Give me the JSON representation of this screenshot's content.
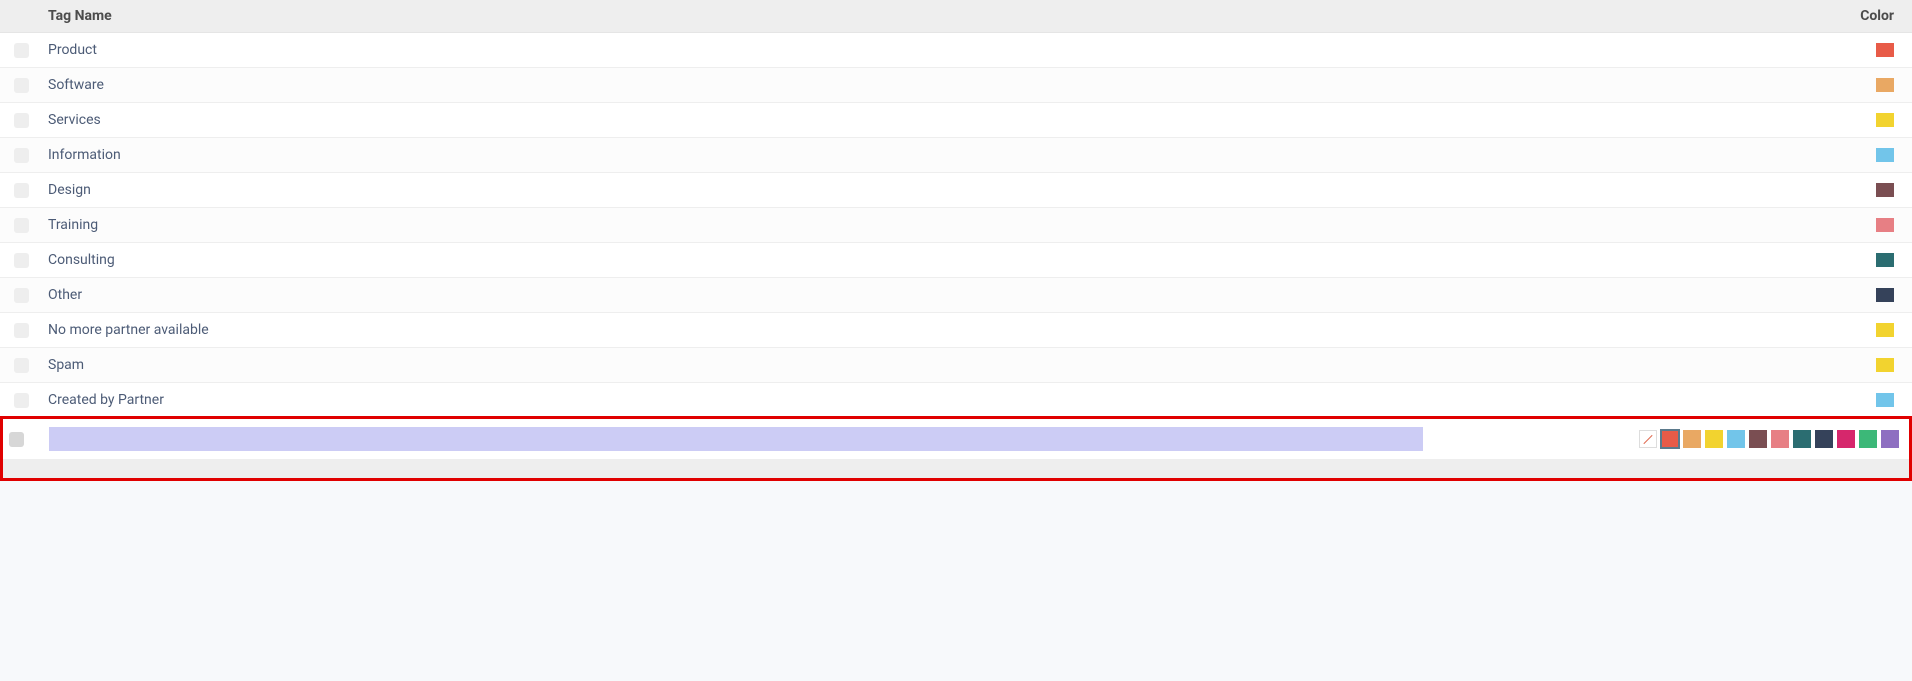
{
  "header": {
    "tag_name": "Tag Name",
    "color": "Color"
  },
  "rows": [
    {
      "name": "Product",
      "color": "#e85b48"
    },
    {
      "name": "Software",
      "color": "#e9a863"
    },
    {
      "name": "Services",
      "color": "#f2d32f"
    },
    {
      "name": "Information",
      "color": "#72c5ea"
    },
    {
      "name": "Design",
      "color": "#7a4e52"
    },
    {
      "name": "Training",
      "color": "#e77f84"
    },
    {
      "name": "Consulting",
      "color": "#2b6d71"
    },
    {
      "name": "Other",
      "color": "#35425a"
    },
    {
      "name": "No more partner available",
      "color": "#f2d32f"
    },
    {
      "name": "Spam",
      "color": "#f2d32f"
    },
    {
      "name": "Created by Partner",
      "color": "#72c5ea"
    }
  ],
  "new_row": {
    "value": "",
    "palette": [
      {
        "color": null,
        "selected": false
      },
      {
        "color": "#e85b48",
        "selected": true
      },
      {
        "color": "#e9a863",
        "selected": false
      },
      {
        "color": "#f2d32f",
        "selected": false
      },
      {
        "color": "#72c5ea",
        "selected": false
      },
      {
        "color": "#7a4e52",
        "selected": false
      },
      {
        "color": "#e77f84",
        "selected": false
      },
      {
        "color": "#2b6d71",
        "selected": false
      },
      {
        "color": "#35425a",
        "selected": false
      },
      {
        "color": "#d6276c",
        "selected": false
      },
      {
        "color": "#3cb878",
        "selected": false
      },
      {
        "color": "#8e6fc1",
        "selected": false
      }
    ]
  }
}
